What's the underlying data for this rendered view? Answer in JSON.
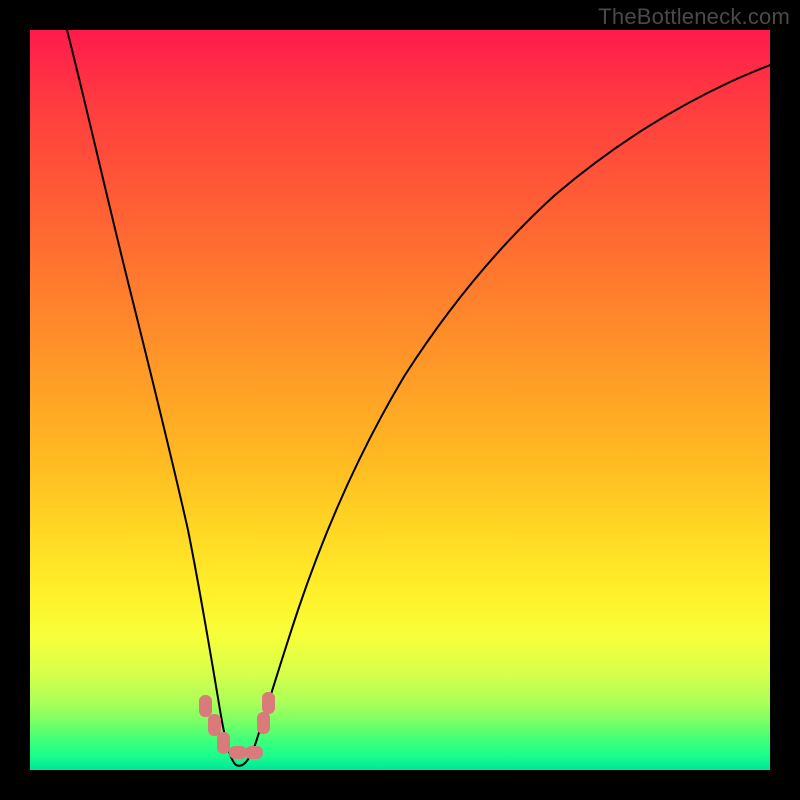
{
  "watermark": "TheBottleneck.com",
  "colors": {
    "frame_bg": "#000000",
    "gradient_top": "#ff1a4d",
    "gradient_bottom": "#00e59a",
    "curve_stroke": "#000000",
    "marker_fill": "#d97b7b"
  },
  "chart_data": {
    "type": "line",
    "title": "",
    "xlabel": "",
    "ylabel": "",
    "xlim": [
      0,
      100
    ],
    "ylim": [
      0,
      100
    ],
    "grid": false,
    "note": "Values estimated from pixel positions; y=0 at bottom (green) rising to y=100 at top (red). Curve is a V-shaped bottleneck curve with minimum near x≈27.",
    "series": [
      {
        "name": "bottleneck-curve",
        "x": [
          5,
          8,
          11,
          14,
          17,
          20,
          22,
          24,
          25,
          26,
          27,
          28,
          29,
          30,
          33,
          37,
          42,
          48,
          55,
          63,
          72,
          82,
          92,
          100
        ],
        "y": [
          100,
          88,
          76,
          64,
          51,
          37,
          26,
          15,
          9,
          4,
          1,
          1,
          3,
          6,
          15,
          26,
          38,
          49,
          58,
          66,
          73,
          79,
          83,
          86
        ]
      }
    ],
    "markers": [
      {
        "x": 23.5,
        "y": 8.5
      },
      {
        "x": 24.5,
        "y": 6.0
      },
      {
        "x": 25.8,
        "y": 3.5
      },
      {
        "x": 27.5,
        "y": 2.2
      },
      {
        "x": 29.3,
        "y": 2.2
      },
      {
        "x": 31.2,
        "y": 6.5
      },
      {
        "x": 31.8,
        "y": 9.5
      }
    ]
  }
}
